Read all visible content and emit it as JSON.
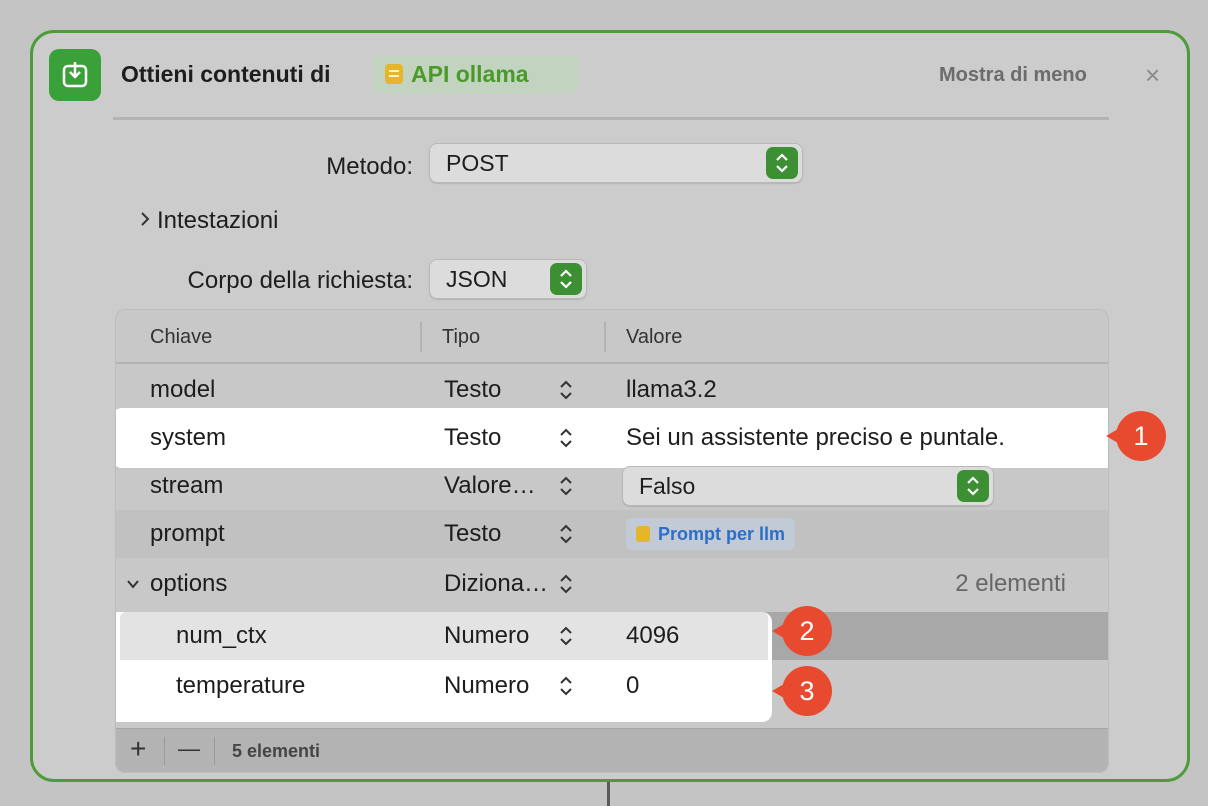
{
  "action": {
    "title": "Ottieni contenuti di",
    "variable": "API ollama",
    "show_less": "Mostra di meno",
    "close_glyph": "×",
    "icon": "download-icon",
    "accent": "#3aa13a"
  },
  "form": {
    "method_label": "Metodo:",
    "method_value": "POST",
    "headers_label": "Intestazioni",
    "body_label": "Corpo della richiesta:",
    "body_value": "JSON"
  },
  "table": {
    "headers": {
      "key": "Chiave",
      "type": "Tipo",
      "value": "Valore"
    },
    "rows": [
      {
        "key": "model",
        "type": "Testo",
        "value": "llama3.2"
      },
      {
        "key": "system",
        "type": "Testo",
        "value": "Sei un assistente preciso e puntale."
      },
      {
        "key": "stream",
        "type": "Valore…",
        "value": "Falso"
      },
      {
        "key": "prompt",
        "type": "Testo",
        "value": "Prompt per llm"
      },
      {
        "key": "options",
        "type": "Diziona…",
        "value": "2 elementi"
      },
      {
        "key": "num_ctx",
        "type": "Numero",
        "value": "4096"
      },
      {
        "key": "temperature",
        "type": "Numero",
        "value": "0"
      }
    ],
    "footer": {
      "add": "+",
      "remove": "—",
      "count": "5 elementi"
    }
  },
  "badges": [
    "1",
    "2",
    "3"
  ],
  "colors": {
    "badge": "#e84a2f",
    "border": "#4f9a3a",
    "token_text": "#2a6fc9"
  }
}
